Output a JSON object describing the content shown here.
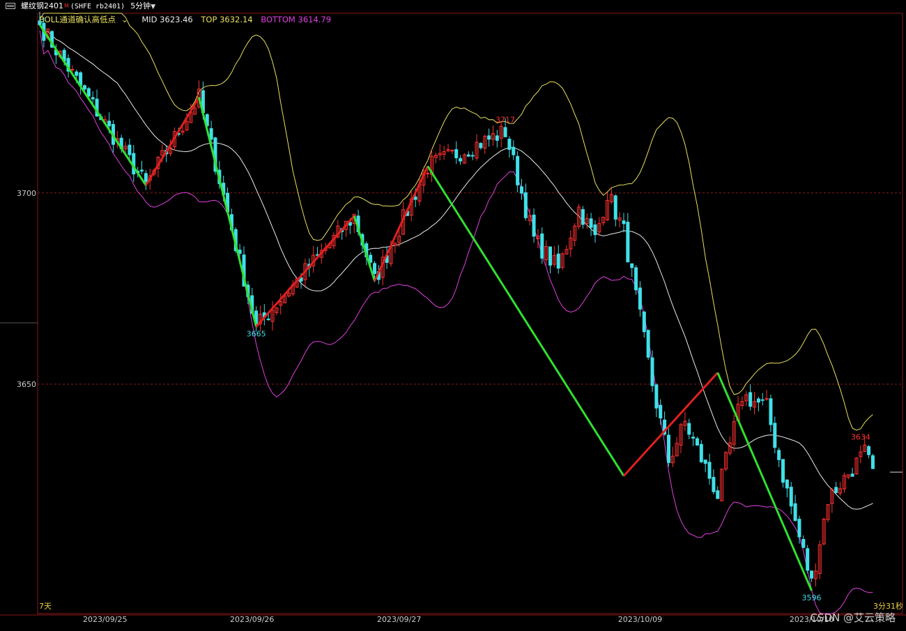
{
  "titlebar": {
    "symbol": "螺纹钢2401",
    "flag": "M",
    "code": "(SHFE rb2401)",
    "period": "5分钟",
    "period_chevron_icon": "chevron-down-icon",
    "window_icon": "window-restore-icon"
  },
  "indicator": {
    "name": "BOLL通道确认高低点",
    "mid": "MID 3623.46",
    "top": "TOP 3632.14",
    "bottom": "BOTTOM 3614.79"
  },
  "colors": {
    "up": "#ff3030",
    "down": "#40e0e8",
    "mid": "#eaeaea",
    "top": "#e8e060",
    "bottom": "#e040e0",
    "zig_up": "#e02020",
    "zig_down": "#30e030",
    "grid": "#8a1a1a"
  },
  "corner": {
    "left": "7天",
    "right": "3分31秒"
  },
  "watermark": "CSDN @艾云策略",
  "chart_data": {
    "type": "candlestick",
    "title": "",
    "ylim": [
      3590,
      3747
    ],
    "y_ticks": [
      3700,
      3650
    ],
    "x_ticks": [
      {
        "i": 16,
        "label": "2023/09/25"
      },
      {
        "i": 52,
        "label": "2023/09/26"
      },
      {
        "i": 88,
        "label": "2023/09/27"
      },
      {
        "i": 147,
        "label": "2023/10/09"
      },
      {
        "i": 189,
        "label": "2023/10/10"
      }
    ],
    "n_bars": 205,
    "pivots": [
      {
        "i": 0,
        "v": 3744
      },
      {
        "i": 26,
        "v": 3702
      },
      {
        "i": 39,
        "v": 3725
      },
      {
        "i": 53,
        "v": 3665
      },
      {
        "i": 77,
        "v": 3694
      },
      {
        "i": 82,
        "v": 3677
      },
      {
        "i": 95,
        "v": 3707
      },
      {
        "i": 114,
        "v": 3716
      },
      {
        "i": 121,
        "v": 3688
      },
      {
        "i": 127,
        "v": 3680
      },
      {
        "i": 132,
        "v": 3696
      },
      {
        "i": 136,
        "v": 3688
      },
      {
        "i": 139,
        "v": 3700
      },
      {
        "i": 143,
        "v": 3690
      },
      {
        "i": 150,
        "v": 3650
      },
      {
        "i": 154,
        "v": 3630
      },
      {
        "i": 158,
        "v": 3640
      },
      {
        "i": 166,
        "v": 3621
      },
      {
        "i": 172,
        "v": 3647
      },
      {
        "i": 178,
        "v": 3644
      },
      {
        "i": 182,
        "v": 3626
      },
      {
        "i": 189,
        "v": 3598
      },
      {
        "i": 193,
        "v": 3620
      },
      {
        "i": 199,
        "v": 3628
      },
      {
        "i": 202,
        "v": 3632
      },
      {
        "i": 204,
        "v": 3627
      }
    ],
    "zigzag": [
      {
        "i": 0,
        "v": 3744
      },
      {
        "i": 26,
        "v": 3702
      },
      {
        "i": 39,
        "v": 3725
      },
      {
        "i": 53,
        "v": 3665
      },
      {
        "i": 77,
        "v": 3694
      },
      {
        "i": 82,
        "v": 3677
      },
      {
        "i": 95,
        "v": 3707
      },
      {
        "i": 143,
        "v": 3626
      },
      {
        "i": 166,
        "v": 3653
      },
      {
        "i": 189,
        "v": 3596
      }
    ],
    "labels": [
      {
        "i": 53,
        "v": 3665,
        "text": "3665",
        "pos": "below",
        "color": "#40e0e8"
      },
      {
        "i": 114,
        "v": 3717,
        "text": "3717",
        "pos": "above",
        "color": "#ff3030"
      },
      {
        "i": 189,
        "v": 3596,
        "text": "3596",
        "pos": "below",
        "color": "#40e0e8"
      },
      {
        "i": 201,
        "v": 3634,
        "text": "3634",
        "pos": "above",
        "color": "#ff3030"
      }
    ],
    "last_price": 3627
  }
}
